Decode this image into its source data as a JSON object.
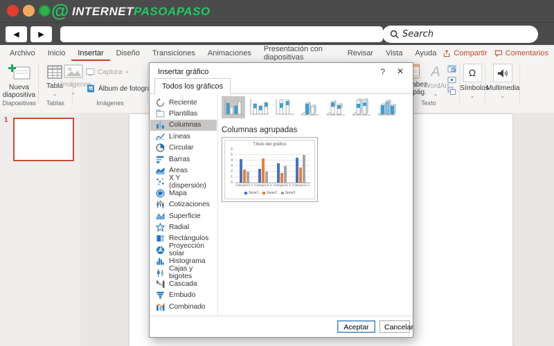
{
  "browser": {
    "brand_1": "INTERNET",
    "brand_2": "PASOAPASO",
    "back_icon": "◀",
    "forward_icon": "▶",
    "search_label": "Search",
    "address_value": ""
  },
  "menu": {
    "tabs": [
      "Archivo",
      "Inicio",
      "Insertar",
      "Diseño",
      "Transiciones",
      "Animaciones",
      "Presentación con diapositivas",
      "Revisar",
      "Vista",
      "Ayuda"
    ],
    "active_tab": "Insertar",
    "share": "Compartir",
    "comments": "Comentarios"
  },
  "ui": {
    "caret": "⌄"
  },
  "ribbon": {
    "new_slide": "Nueva diapositiva",
    "table": "Tabla",
    "images": "Imágenes",
    "capture": "Captura",
    "photo_album": "Álbum de fotografías",
    "header_footer_line1": "Encabez.",
    "header_footer_line2": "pie pág.",
    "wordart": "WordArt",
    "symbols": "Símbolos",
    "multimedia": "Multimedia",
    "groups": {
      "slides": "Diapositivas",
      "tables": "Tablas",
      "images": "Imágenes",
      "text": "Texto"
    }
  },
  "slides_panel": {
    "slide_number": "1"
  },
  "dialog": {
    "title": "Insertar gráfico",
    "help_icon": "?",
    "close_icon": "✕",
    "tab": "Todos los gráficos",
    "subtype_title": "Columnas agrupadas",
    "categories": [
      {
        "label": "Reciente",
        "icon": "recent-icon",
        "selected": false
      },
      {
        "label": "Plantillas",
        "icon": "templates-icon",
        "selected": false
      },
      {
        "label": "Columnas",
        "icon": "columns-icon",
        "selected": true
      },
      {
        "label": "Líneas",
        "icon": "lines-icon",
        "selected": false
      },
      {
        "label": "Circular",
        "icon": "pie-icon",
        "selected": false
      },
      {
        "label": "Barras",
        "icon": "bars-icon",
        "selected": false
      },
      {
        "label": "Áreas",
        "icon": "area-icon",
        "selected": false
      },
      {
        "label": "X Y (dispersión)",
        "icon": "scatter-icon",
        "selected": false
      },
      {
        "label": "Mapa",
        "icon": "map-icon",
        "selected": false
      },
      {
        "label": "Cotizaciones",
        "icon": "stock-icon",
        "selected": false
      },
      {
        "label": "Superficie",
        "icon": "surface-icon",
        "selected": false
      },
      {
        "label": "Radial",
        "icon": "radar-icon",
        "selected": false
      },
      {
        "label": "Rectángulos",
        "icon": "treemap-icon",
        "selected": false
      },
      {
        "label": "Proyección solar",
        "icon": "sunburst-icon",
        "selected": false
      },
      {
        "label": "Histograma",
        "icon": "histogram-icon",
        "selected": false
      },
      {
        "label": "Cajas y bigotes",
        "icon": "boxwhisker-icon",
        "selected": false
      },
      {
        "label": "Cascada",
        "icon": "waterfall-icon",
        "selected": false
      },
      {
        "label": "Embudo",
        "icon": "funnel-icon",
        "selected": false
      },
      {
        "label": "Combinado",
        "icon": "combo-icon",
        "selected": false
      }
    ],
    "subtypes": [
      {
        "name": "clustered-column",
        "selected": true
      },
      {
        "name": "stacked-column",
        "selected": false
      },
      {
        "name": "100-stacked-column",
        "selected": false
      },
      {
        "name": "3d-clustered-column",
        "selected": false
      },
      {
        "name": "3d-stacked-column",
        "selected": false
      },
      {
        "name": "3d-100-stacked-column",
        "selected": false
      },
      {
        "name": "3d-column",
        "selected": false
      }
    ],
    "ok_button": "Aceptar",
    "cancel_button": "Cancelar"
  },
  "chart_data": {
    "type": "bar",
    "title": "Título del gráfico",
    "categories": [
      "Categoría 1",
      "Categoría 2",
      "Categoría 3",
      "Categoría 4"
    ],
    "series": [
      {
        "name": "Serie1",
        "color": "#4472C4",
        "values": [
          4.3,
          2.5,
          3.5,
          4.5
        ]
      },
      {
        "name": "Serie2",
        "color": "#ED7D31",
        "values": [
          2.4,
          4.4,
          1.8,
          2.8
        ]
      },
      {
        "name": "Serie3",
        "color": "#A5A5A5",
        "values": [
          2.0,
          2.0,
          3.0,
          5.0
        ]
      }
    ],
    "ylim": [
      0,
      6
    ],
    "yticks": [
      0,
      1,
      2,
      3,
      4,
      5,
      6
    ],
    "grid": true,
    "legend_position": "bottom"
  },
  "colors": {
    "accent_red": "#C2401F",
    "brand_green": "#20CA63",
    "chrome_dark": "#4B4B4B",
    "series_blue": "#4472C4",
    "series_orange": "#ED7D31",
    "series_gray": "#A5A5A5"
  }
}
